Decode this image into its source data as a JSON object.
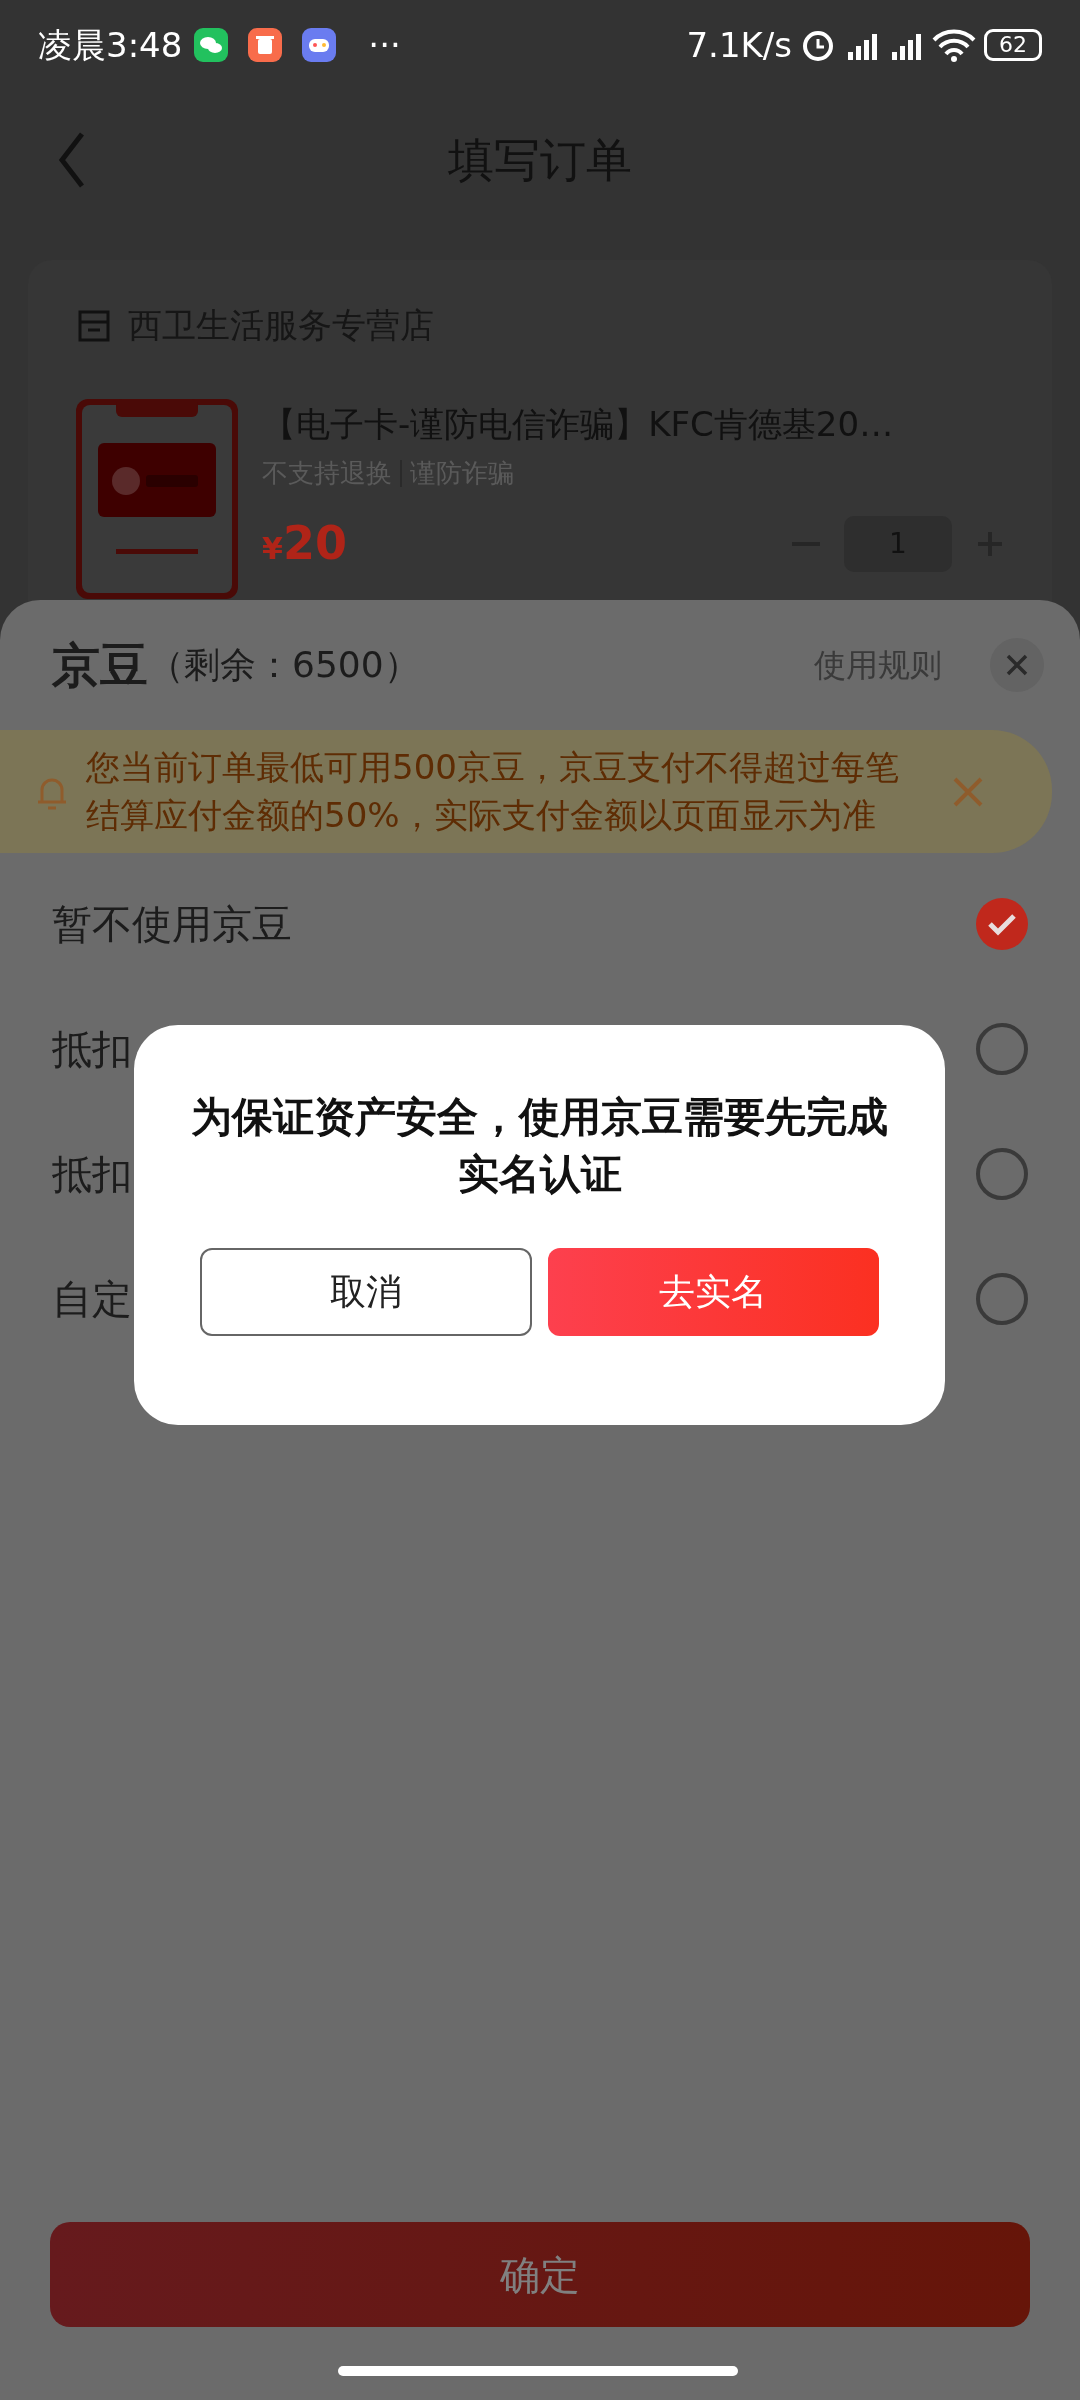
{
  "status_bar": {
    "time": "凌晨3:48",
    "more": "···",
    "net_speed": "7.1K/s",
    "battery": "62"
  },
  "header": {
    "title": "填写订单"
  },
  "store": {
    "name": "西卫生活服务专营店"
  },
  "product": {
    "title": "【电子卡-谨防电信诈骗】KFC肯德基20…",
    "tags": [
      "不支持退换",
      "谨防诈骗"
    ],
    "currency": "¥",
    "price": "20",
    "quantity": "1"
  },
  "sheet": {
    "title": "京豆",
    "remaining": "（剩余：6500）",
    "rules_link": "使用规则",
    "notice": "您当前订单最低可用500京豆，京豆支付不得超过每笔结算应付金额的50%，实际支付金额以页面显示为准",
    "options": [
      {
        "label": "暂不使用京豆",
        "selected": true
      },
      {
        "label": "抵扣",
        "selected": false
      },
      {
        "label": "抵扣",
        "selected": false
      },
      {
        "label": "自定",
        "selected": false
      }
    ],
    "confirm": "确定"
  },
  "dialog": {
    "message": "为保证资产安全，使用京豆需要先完成实名认证",
    "cancel": "取消",
    "confirm": "去实名"
  }
}
